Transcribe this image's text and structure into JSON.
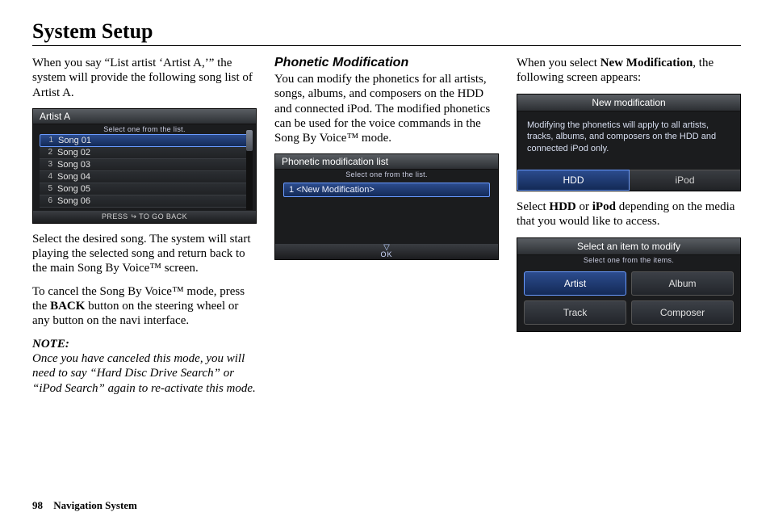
{
  "page": {
    "title": "System Setup",
    "number": "98",
    "section": "Navigation System"
  },
  "col1": {
    "intro": "When you say “List artist ‘Artist A,’” the system will provide the following song list of Artist A.",
    "frame": {
      "title": "Artist A",
      "instruct": "Select one from the list.",
      "songs": [
        {
          "n": "1",
          "label": "Song 01",
          "selected": true
        },
        {
          "n": "2",
          "label": "Song 02",
          "selected": false
        },
        {
          "n": "3",
          "label": "Song 03",
          "selected": false
        },
        {
          "n": "4",
          "label": "Song 04",
          "selected": false
        },
        {
          "n": "5",
          "label": "Song 05",
          "selected": false
        },
        {
          "n": "6",
          "label": "Song 06",
          "selected": false
        }
      ],
      "footer_pre": "PRESS ",
      "footer_post": " TO GO BACK"
    },
    "p2": "Select the desired song. The system will start playing the selected song and return back to the main Song By Voice™ screen.",
    "p3_pre": "To cancel the Song By Voice™ mode, press the ",
    "p3_bold": "BACK",
    "p3_post": " button on the steering wheel or any button on the navi interface.",
    "note_label": "NOTE:",
    "note_body": "Once you have canceled this mode, you will need to say “Hard Disc Drive Search” or “iPod Search” again to re-activate this mode."
  },
  "col2": {
    "heading": "Phonetic Modification",
    "p1": "You can modify the phonetics for all artists, songs, albums, and composers on the HDD and connected iPod. The modified phonetics can be used for the voice commands in the Song By Voice™ mode.",
    "frame": {
      "title": "Phonetic modification list",
      "instruct": "Select one from the list.",
      "row_num": "1",
      "row_label": "<New Modification>",
      "ok": "OK"
    }
  },
  "col3": {
    "p1_pre": "When you select ",
    "p1_bold": "New Modification",
    "p1_post": ", the following screen appears:",
    "frame1": {
      "title": "New modification",
      "info": "Modifying the phonetics will apply to all artists, tracks, albums, and composers on the HDD and connected iPod only.",
      "tab_hdd": "HDD",
      "tab_ipod": "iPod"
    },
    "p2_pre": "Select ",
    "p2_b1": "HDD",
    "p2_mid": " or ",
    "p2_b2": "iPod",
    "p2_post": " depending on the media that you would like to access.",
    "frame2": {
      "title": "Select an item to modify",
      "instruct": "Select one from the items.",
      "items": {
        "artist": "Artist",
        "album": "Album",
        "track": "Track",
        "composer": "Composer"
      }
    }
  }
}
